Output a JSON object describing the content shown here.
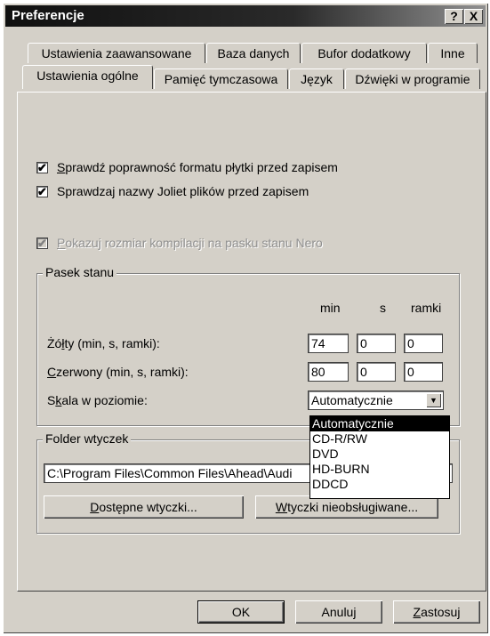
{
  "window": {
    "title": "Preferencje",
    "help_glyph": "?",
    "close_glyph": "X"
  },
  "tabs_back": [
    "Ustawienia zaawansowane",
    "Baza danych",
    "Bufor dodatkowy",
    "Inne"
  ],
  "tabs_front": [
    "Ustawienia ogólne",
    "Pamięć tymczasowa",
    "Język",
    "Dźwięki w programie"
  ],
  "checks": {
    "c1": {
      "mnemonic": "S",
      "rest": "prawdź poprawność formatu płytki przed zapisem",
      "checked": true
    },
    "c2": {
      "text": "Sprawdzaj nazwy Joliet plików przed zapisem",
      "checked": true
    },
    "c3": {
      "mnemonic": "P",
      "rest": "okazuj rozmiar kompilacji na pasku stanu Nero",
      "checked": true,
      "disabled": true
    },
    "check_glyph": "✔"
  },
  "status_bar": {
    "title": "Pasek stanu",
    "col_min": "min",
    "col_s": "s",
    "col_frames": "ramki",
    "yellow": {
      "pre": "Żó",
      "mn": "ł",
      "post": "ty (min, s, ramki):",
      "min": "74",
      "s": "0",
      "frames": "0"
    },
    "red": {
      "mn": "C",
      "post": "zerwony (min, s, ramki):",
      "min": "80",
      "s": "0",
      "frames": "0"
    },
    "scale": {
      "pre": "S",
      "mn": "k",
      "post": "ala w poziomie:",
      "value": "Automatycznie"
    },
    "scale_options": [
      "Automatycznie",
      "CD-R/RW",
      "DVD",
      "HD-BURN",
      "DDCD"
    ]
  },
  "plugins": {
    "title": "Folder wtyczek",
    "path": "C:\\Program Files\\Common Files\\Ahead\\Audi",
    "available": {
      "mn": "D",
      "post": "ostępne wtyczki..."
    },
    "unsupported": {
      "mn": "W",
      "post": "tyczki nieobsługiwane..."
    }
  },
  "buttons": {
    "ok": "OK",
    "cancel": "Anuluj",
    "apply_mn": "Z",
    "apply_post": "astosuj"
  },
  "arrow_glyph": "▼"
}
